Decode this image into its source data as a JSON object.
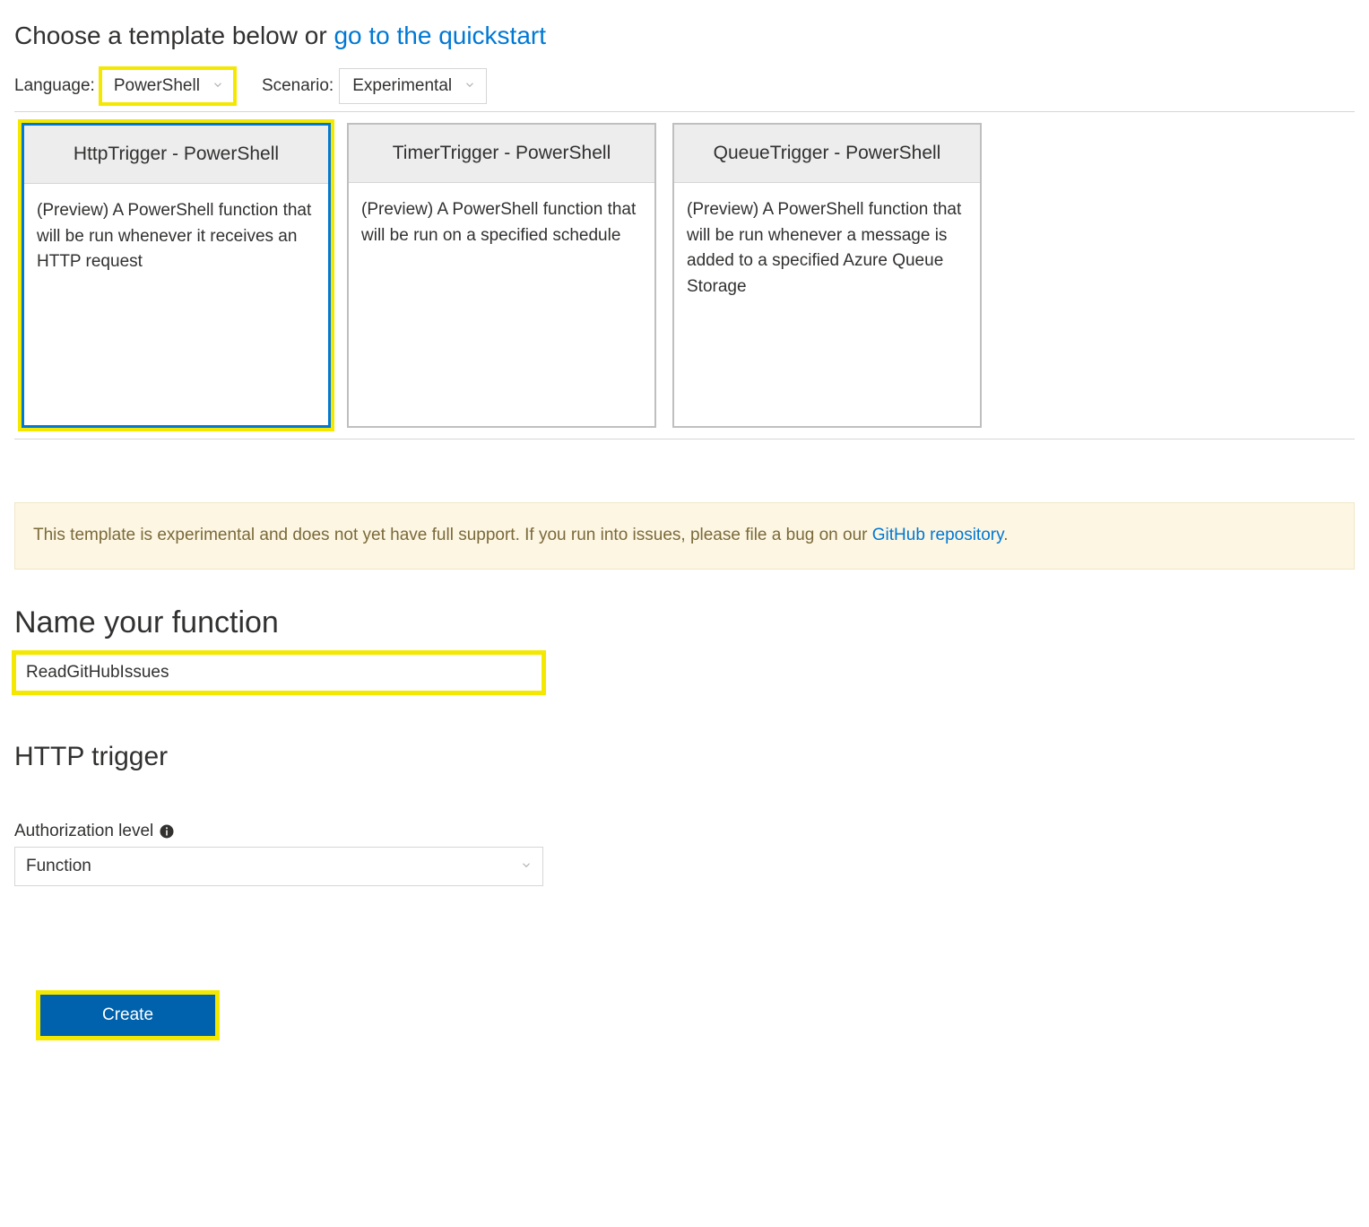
{
  "header": {
    "prefix": "Choose a template below or ",
    "link_text": "go to the quickstart"
  },
  "filters": {
    "language_label": "Language:",
    "language_value": "PowerShell",
    "scenario_label": "Scenario:",
    "scenario_value": "Experimental"
  },
  "templates": [
    {
      "title": "HttpTrigger - PowerShell",
      "description": "(Preview) A PowerShell function that will be run whenever it receives an HTTP request",
      "selected": true
    },
    {
      "title": "TimerTrigger - PowerShell",
      "description": "(Preview) A PowerShell function that will be run on a specified schedule",
      "selected": false
    },
    {
      "title": "QueueTrigger - PowerShell",
      "description": "(Preview) A PowerShell function that will be run whenever a message is added to a specified Azure Queue Storage",
      "selected": false
    }
  ],
  "warning": {
    "text_prefix": "This template is experimental and does not yet have full support. If you run into issues, please file a bug on our ",
    "link_text": "GitHub repository",
    "text_suffix": "."
  },
  "name_section": {
    "heading": "Name your function",
    "value": "ReadGitHubIssues"
  },
  "trigger_section": {
    "heading": "HTTP trigger",
    "auth_label": "Authorization level",
    "auth_value": "Function"
  },
  "actions": {
    "create_label": "Create"
  }
}
